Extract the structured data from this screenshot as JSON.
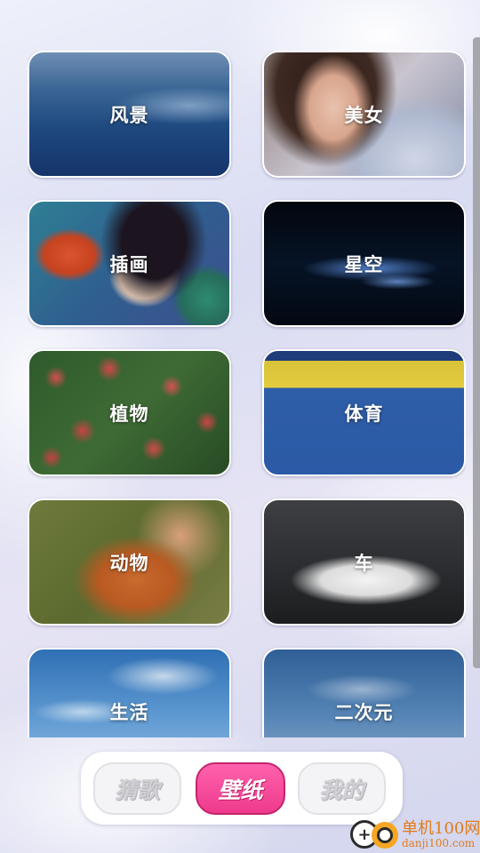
{
  "categories": [
    {
      "label": "风景"
    },
    {
      "label": "美女"
    },
    {
      "label": "插画"
    },
    {
      "label": "星空"
    },
    {
      "label": "植物"
    },
    {
      "label": "体育"
    },
    {
      "label": "动物"
    },
    {
      "label": "车"
    },
    {
      "label": "生活"
    },
    {
      "label": "二次元"
    }
  ],
  "tabbar": {
    "tabs": [
      {
        "label": "猜歌",
        "active": false
      },
      {
        "label": "壁纸",
        "active": true
      },
      {
        "label": "我的",
        "active": false
      }
    ],
    "active_color": "#ee3a8c"
  },
  "watermark": {
    "title": "单机100网",
    "url": "danji100.com"
  }
}
